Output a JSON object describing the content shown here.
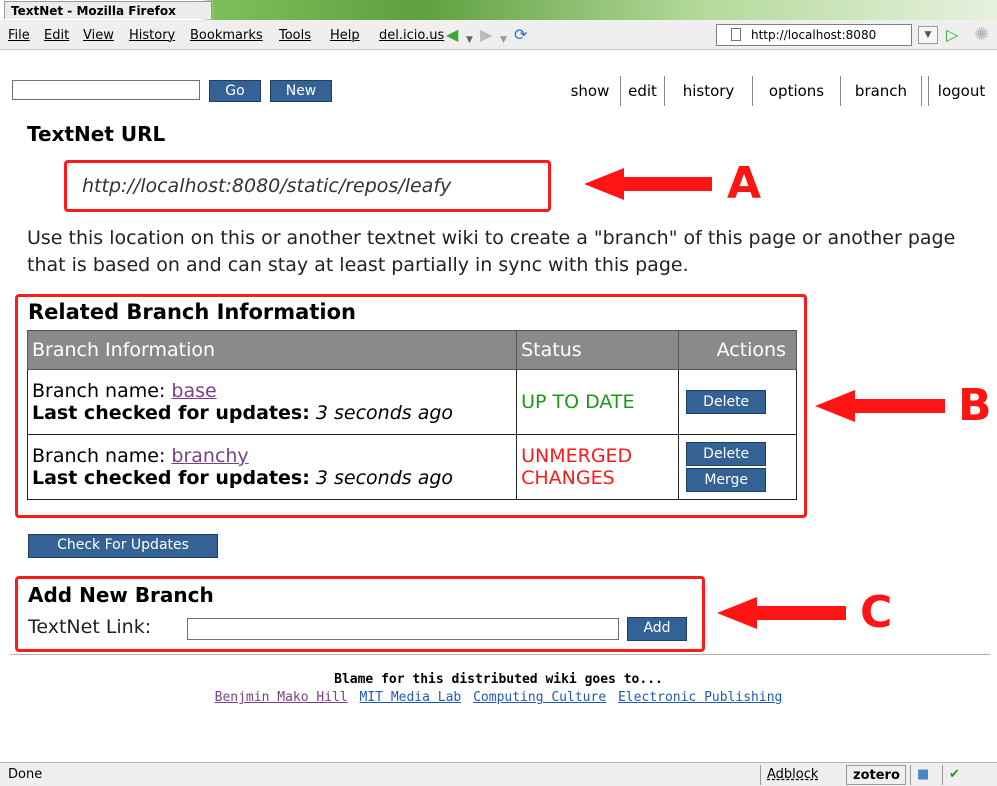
{
  "window": {
    "title": "TextNet - Mozilla Firefox"
  },
  "menubar": {
    "items": [
      "File",
      "Edit",
      "View",
      "History",
      "Bookmarks",
      "Tools",
      "Help",
      "del.icio.us"
    ],
    "url": "http://localhost:8080"
  },
  "toolbar": {
    "go_label": "Go",
    "new_label": "New",
    "tabs": [
      "show",
      "edit",
      "history",
      "options",
      "branch",
      "logout"
    ]
  },
  "main": {
    "textnet_heading": "TextNet URL",
    "textnet_url": "http://localhost:8080/static/repos/leafy",
    "description": "Use this location on this or another textnet wiki to create a \"branch\" of this page or another page that is based on and can stay at least partially in sync with this page.",
    "related_heading": "Related Branch Information",
    "table_headers": [
      "Branch Information",
      "Status",
      "Actions"
    ],
    "branch_name_label": "Branch name:",
    "last_checked_label": "Last checked for updates:",
    "rows": [
      {
        "name": "base",
        "checked": "3 seconds ago",
        "status": "UP TO DATE",
        "actions": [
          "Delete"
        ]
      },
      {
        "name": "branchy",
        "checked": "3 seconds ago",
        "status_line1": "UNMERGED",
        "status_line2": "CHANGES",
        "actions": [
          "Delete",
          "Merge"
        ]
      }
    ],
    "check_updates_label": "Check For Updates",
    "add_heading": "Add New Branch",
    "add_label": "TextNet Link:",
    "add_button": "Add"
  },
  "annotations": {
    "a": "A",
    "b": "B",
    "c": "C"
  },
  "footer": {
    "title": "Blame for this distributed wiki goes to...",
    "links": [
      "Benjmin Mako Hill",
      "MIT Media Lab",
      "Computing Culture",
      "Electronic Publishing"
    ]
  },
  "statusbar": {
    "status": "Done",
    "adblock": "Adblock",
    "zotero": "zotero"
  },
  "colors": {
    "accent_button": "#356295",
    "annotation_red": "#ff1414",
    "up_to_date": "#1a9a1a"
  }
}
